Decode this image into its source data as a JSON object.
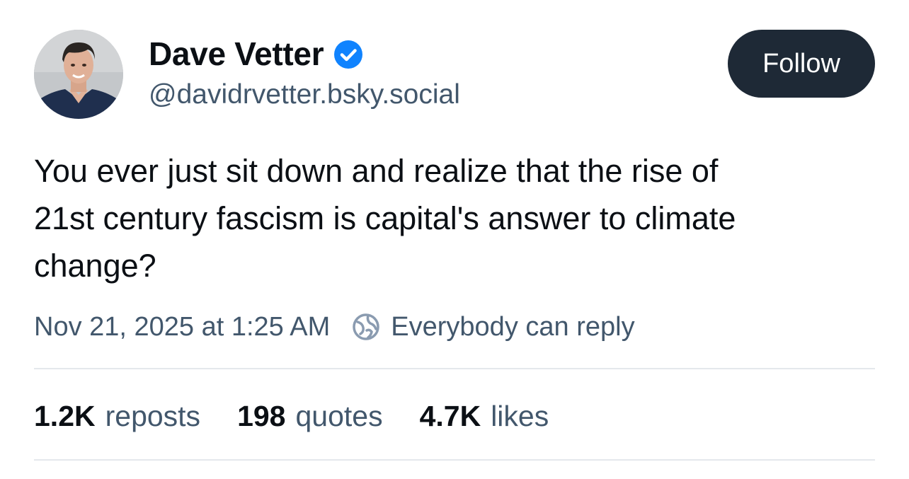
{
  "author": {
    "display_name": "Dave Vetter",
    "handle": "@davidrvetter.bsky.social",
    "verified_icon": "verified-check-icon",
    "avatar_icon": "profile-photo"
  },
  "follow_button": {
    "label": "Follow"
  },
  "post": {
    "lines": [
      "You ever just sit down and realize that the rise of",
      "21st century fascism is capital's answer to climate",
      "change?"
    ]
  },
  "meta": {
    "timestamp": "Nov 21, 2025 at 1:25 AM",
    "reply_icon": "globe-icon",
    "reply_setting": "Everybody can reply"
  },
  "stats": {
    "reposts": {
      "count": "1.2K",
      "label": "reposts"
    },
    "quotes": {
      "count": "198",
      "label": "quotes"
    },
    "likes": {
      "count": "4.7K",
      "label": "likes"
    }
  },
  "colors": {
    "text": "#0b0f14",
    "muted": "#42576c",
    "verified": "#1083fe",
    "follow_bg": "#1e2936",
    "divider": "#e4e8ec"
  }
}
